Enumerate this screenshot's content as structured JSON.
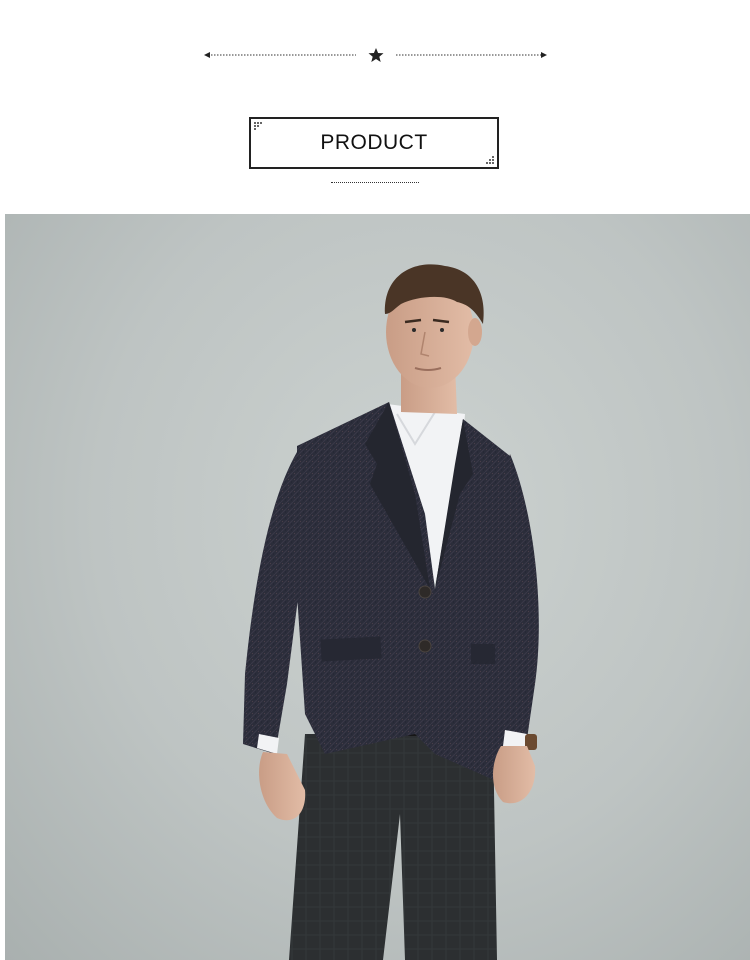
{
  "section": {
    "title": "PRODUCT"
  },
  "photo": {
    "subject": "man-in-tweed-blazer",
    "colors": {
      "background": "#c3c9c8",
      "jacket": "#2b2d3a",
      "shirt": "#f2f3f5",
      "trousers": "#2c2f31",
      "skin": "#d7b19a",
      "hair": "#4a3526"
    }
  },
  "ornament": {
    "icon": "star-icon"
  }
}
